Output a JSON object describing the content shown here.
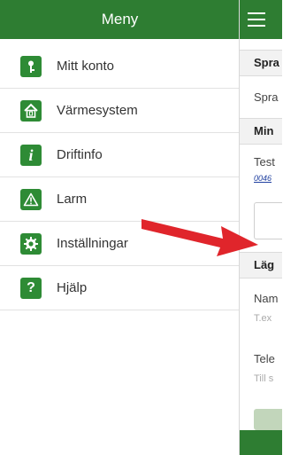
{
  "menu": {
    "title": "Meny",
    "items": [
      {
        "label": "Mitt konto",
        "icon": "key-icon"
      },
      {
        "label": "Värmesystem",
        "icon": "house-icon"
      },
      {
        "label": "Driftinfo",
        "icon": "info-icon"
      },
      {
        "label": "Larm",
        "icon": "warning-icon"
      },
      {
        "label": "Inställningar",
        "icon": "gear-icon"
      },
      {
        "label": "Hjälp",
        "icon": "question-icon"
      }
    ]
  },
  "content": {
    "sections": [
      {
        "heading": "Spra",
        "text": "Spra"
      },
      {
        "heading": "Min",
        "text": "Test",
        "link": "0046"
      },
      {
        "heading": "Läg",
        "field1_label": "Nam",
        "field1_placeholder": "T.ex",
        "field2_label": "Tele",
        "field2_placeholder": "Till s"
      }
    ]
  },
  "colors": {
    "accent": "#2e7d32",
    "icon_bg": "#2e8b35",
    "arrow": "#e0252b"
  }
}
